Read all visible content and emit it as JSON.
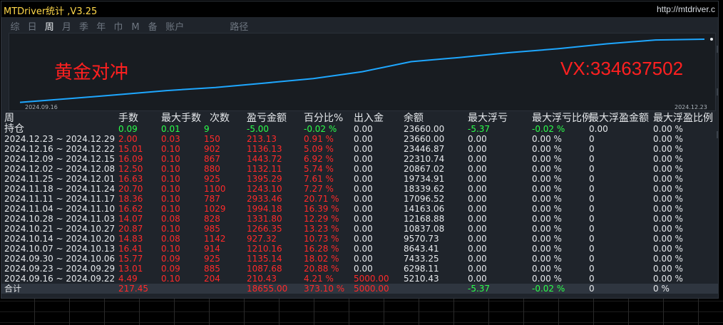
{
  "app": {
    "title": "MTDriver统计 ,V3.25",
    "url": "http://mtdriver.c"
  },
  "tabs": [
    {
      "label": "综",
      "active": false
    },
    {
      "label": "日",
      "active": false
    },
    {
      "label": "周",
      "active": true
    },
    {
      "label": "月",
      "active": false
    },
    {
      "label": "季",
      "active": false
    },
    {
      "label": "年",
      "active": false
    },
    {
      "label": "巾",
      "active": false
    },
    {
      "label": "M",
      "active": false
    },
    {
      "label": "备",
      "active": false
    },
    {
      "label": "账户",
      "active": false
    },
    {
      "label": "路径",
      "active": false
    }
  ],
  "chart_watermarks": {
    "left": "黄金对冲",
    "right": "VX:334637502"
  },
  "chart_data": {
    "type": "line",
    "x_start_label": "2024.09.16",
    "x_end_label": "2024.12.23",
    "x": [
      "2024.09.16",
      "2024.09.23",
      "2024.09.30",
      "2024.10.07",
      "2024.10.14",
      "2024.10.21",
      "2024.10.28",
      "2024.11.04",
      "2024.11.11",
      "2024.11.18",
      "2024.11.25",
      "2024.12.02",
      "2024.12.09",
      "2024.12.16",
      "2024.12.23"
    ],
    "y": [
      5210.43,
      6298.11,
      7433.25,
      8643.41,
      9570.73,
      10837.08,
      12168.88,
      14163.06,
      17096.52,
      18339.62,
      19734.91,
      20867.02,
      22310.74,
      23446.87,
      23660.0
    ],
    "ylim": [
      4500,
      24500
    ],
    "line_color": "#1ea7ff"
  },
  "table": {
    "headers": [
      "周",
      "手数",
      "最大手数",
      "次数",
      "盈亏金额",
      "百分比%",
      "出入金",
      "余额",
      "最大浮亏",
      "最大浮亏比例",
      "最大浮盈金额",
      "最大浮盈比例"
    ],
    "holding": {
      "label": "持仓",
      "lots": "0.09",
      "max_lots": "0.01",
      "count": "9",
      "pnl": "-5.00",
      "pct": "-0.02 %",
      "io": "0.00",
      "balance": "23660.00",
      "max_float_loss": "-5.37",
      "max_float_loss_pct": "-0.02 %",
      "max_float_profit": "0.00",
      "max_float_profit_pct": "0.00 %"
    },
    "rows": [
      {
        "week": "2024.12.23 ~ 2024.12.29",
        "lots": "2.00",
        "max_lots": "0.03",
        "count": "150",
        "pnl": "213.13",
        "pct": "0.91 %",
        "io": "0.00",
        "balance": "23660.00",
        "mfl": "0.00",
        "mflp": "0.00 %",
        "mfp": "0",
        "mfpp": "0.00 %"
      },
      {
        "week": "2024.12.16 ~ 2024.12.22",
        "lots": "15.01",
        "max_lots": "0.10",
        "count": "902",
        "pnl": "1136.13",
        "pct": "5.09 %",
        "io": "0.00",
        "balance": "23446.87",
        "mfl": "0.00",
        "mflp": "0.00 %",
        "mfp": "0",
        "mfpp": "0.00 %"
      },
      {
        "week": "2024.12.09 ~ 2024.12.15",
        "lots": "16.09",
        "max_lots": "0.10",
        "count": "867",
        "pnl": "1443.72",
        "pct": "6.92 %",
        "io": "0.00",
        "balance": "22310.74",
        "mfl": "0.00",
        "mflp": "0.00 %",
        "mfp": "0",
        "mfpp": "0.00 %"
      },
      {
        "week": "2024.12.02 ~ 2024.12.08",
        "lots": "12.50",
        "max_lots": "0.10",
        "count": "880",
        "pnl": "1132.11",
        "pct": "5.74 %",
        "io": "0.00",
        "balance": "20867.02",
        "mfl": "0.00",
        "mflp": "0.00 %",
        "mfp": "0",
        "mfpp": "0.00 %"
      },
      {
        "week": "2024.11.25 ~ 2024.12.01",
        "lots": "16.63",
        "max_lots": "0.10",
        "count": "925",
        "pnl": "1395.29",
        "pct": "7.61 %",
        "io": "0.00",
        "balance": "19734.91",
        "mfl": "0.00",
        "mflp": "0.00 %",
        "mfp": "0",
        "mfpp": "0.00 %"
      },
      {
        "week": "2024.11.18 ~ 2024.11.24",
        "lots": "20.70",
        "max_lots": "0.10",
        "count": "1100",
        "pnl": "1243.10",
        "pct": "7.27 %",
        "io": "0.00",
        "balance": "18339.62",
        "mfl": "0.00",
        "mflp": "0.00 %",
        "mfp": "0",
        "mfpp": "0.00 %"
      },
      {
        "week": "2024.11.11 ~ 2024.11.17",
        "lots": "18.36",
        "max_lots": "0.10",
        "count": "787",
        "pnl": "2933.46",
        "pct": "20.71 %",
        "io": "0.00",
        "balance": "17096.52",
        "mfl": "0.00",
        "mflp": "0.00 %",
        "mfp": "0",
        "mfpp": "0.00 %"
      },
      {
        "week": "2024.11.04 ~ 2024.11.10",
        "lots": "16.62",
        "max_lots": "0.10",
        "count": "1029",
        "pnl": "1994.18",
        "pct": "16.39 %",
        "io": "0.00",
        "balance": "14163.06",
        "mfl": "0.00",
        "mflp": "0.00 %",
        "mfp": "0",
        "mfpp": "0.00 %"
      },
      {
        "week": "2024.10.28 ~ 2024.11.03",
        "lots": "14.07",
        "max_lots": "0.08",
        "count": "828",
        "pnl": "1331.80",
        "pct": "12.29 %",
        "io": "0.00",
        "balance": "12168.88",
        "mfl": "0.00",
        "mflp": "0.00 %",
        "mfp": "0",
        "mfpp": "0.00 %"
      },
      {
        "week": "2024.10.21 ~ 2024.10.27",
        "lots": "20.87",
        "max_lots": "0.10",
        "count": "985",
        "pnl": "1266.35",
        "pct": "13.23 %",
        "io": "0.00",
        "balance": "10837.08",
        "mfl": "0.00",
        "mflp": "0.00 %",
        "mfp": "0",
        "mfpp": "0.00 %"
      },
      {
        "week": "2024.10.14 ~ 2024.10.20",
        "lots": "14.83",
        "max_lots": "0.08",
        "count": "1142",
        "pnl": "927.32",
        "pct": "10.73 %",
        "io": "0.00",
        "balance": "9570.73",
        "mfl": "0.00",
        "mflp": "0.00 %",
        "mfp": "0",
        "mfpp": "0.00 %"
      },
      {
        "week": "2024.10.07 ~ 2024.10.13",
        "lots": "16.41",
        "max_lots": "0.10",
        "count": "914",
        "pnl": "1210.16",
        "pct": "16.28 %",
        "io": "0.00",
        "balance": "8643.41",
        "mfl": "0.00",
        "mflp": "0.00 %",
        "mfp": "0",
        "mfpp": "0.00 %"
      },
      {
        "week": "2024.09.30 ~ 2024.10.06",
        "lots": "15.77",
        "max_lots": "0.09",
        "count": "925",
        "pnl": "1135.14",
        "pct": "18.02 %",
        "io": "0.00",
        "balance": "7433.25",
        "mfl": "0.00",
        "mflp": "0.00 %",
        "mfp": "0",
        "mfpp": "0.00 %"
      },
      {
        "week": "2024.09.23 ~ 2024.09.29",
        "lots": "13.01",
        "max_lots": "0.09",
        "count": "885",
        "pnl": "1087.68",
        "pct": "20.88 %",
        "io": "0.00",
        "balance": "6298.11",
        "mfl": "0.00",
        "mflp": "0.00 %",
        "mfp": "0",
        "mfpp": "0.00 %"
      },
      {
        "week": "2024.09.16 ~ 2024.09.22",
        "lots": "4.49",
        "max_lots": "0.10",
        "count": "204",
        "pnl": "210.43",
        "pct": "4.21 %",
        "io": "5000.00",
        "balance": "5210.43",
        "mfl": "0.00",
        "mflp": "0.00 %",
        "mfp": "0",
        "mfpp": "0.00 %"
      }
    ],
    "total": {
      "label": "合计",
      "lots": "217.45",
      "pnl": "18655.00",
      "pct": "373.10 %",
      "io": "5000.00",
      "mfl": "-5.37",
      "mflp": "-0.02 %",
      "mfp": "0",
      "mfpp": "0 %"
    }
  }
}
